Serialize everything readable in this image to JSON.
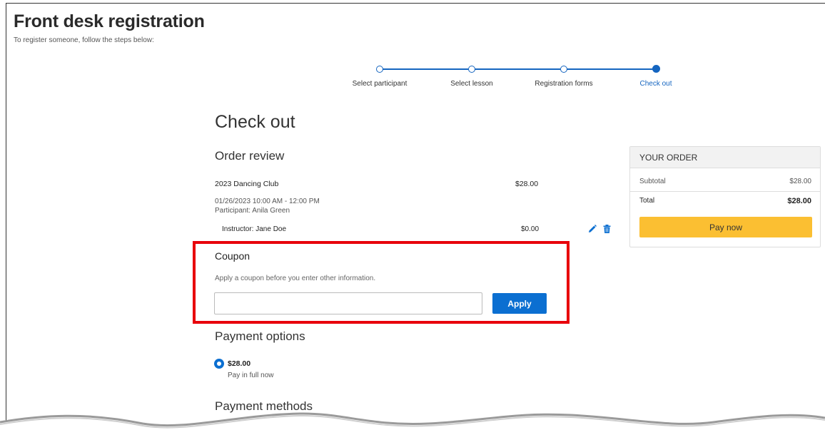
{
  "header": {
    "title": "Front desk registration",
    "subtitle": "To register someone, follow the steps below:"
  },
  "stepper": {
    "steps": [
      {
        "label": "Select participant"
      },
      {
        "label": "Select lesson"
      },
      {
        "label": "Registration forms"
      },
      {
        "label": "Check out"
      }
    ],
    "current_step": 4
  },
  "checkout": {
    "title": "Check out",
    "order_review_title": "Order review",
    "item": {
      "name": "2023 Dancing Club",
      "price": "$28.00",
      "datetime": "01/26/2023 10:00 AM - 12:00 PM",
      "participant": "Participant: Anila Green"
    },
    "instructor": {
      "label": "Instructor: Jane Doe",
      "price": "$0.00"
    }
  },
  "coupon": {
    "title": "Coupon",
    "help": "Apply a coupon before you enter other information.",
    "input_value": "",
    "apply_label": "Apply"
  },
  "payment_options": {
    "title": "Payment options",
    "selected_amount": "$28.00",
    "selected_desc": "Pay in full now"
  },
  "payment_methods": {
    "title": "Payment methods"
  },
  "order_summary": {
    "title": "YOUR ORDER",
    "subtotal_label": "Subtotal",
    "subtotal_value": "$28.00",
    "total_label": "Total",
    "total_value": "$28.00",
    "pay_label": "Pay now"
  },
  "colors": {
    "accent": "#1565c0",
    "apply_button": "#0b6fd1",
    "pay_button": "#fbbf32",
    "highlight": "#e8000b"
  },
  "icons": [
    "edit-pencil-icon",
    "trash-icon"
  ]
}
